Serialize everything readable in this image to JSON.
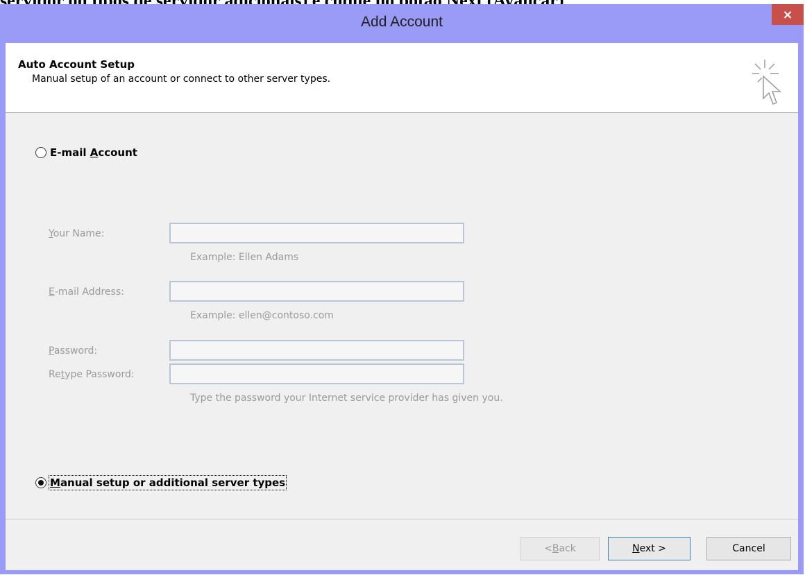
{
  "background_caption": "servidor ou tipos de servidor adicionais) e clique no botão Next (Avançar)",
  "window": {
    "title": "Add Account",
    "close_glyph": "×"
  },
  "header": {
    "title": "Auto Account Setup",
    "subtitle": "Manual setup of an account or connect to other server types.",
    "icon": "wizard-cursor-icon"
  },
  "options": {
    "email_account": {
      "label_prefix": "E-mail ",
      "accel": "A",
      "label_rest": "ccount",
      "selected": false
    },
    "manual_setup": {
      "accel": "M",
      "label_rest": "anual setup or additional server types",
      "selected": true
    }
  },
  "form": {
    "your_name": {
      "accel": "Y",
      "label_rest": "our Name:",
      "value": "",
      "hint": "Example: Ellen Adams"
    },
    "email_address": {
      "accel": "E",
      "label_rest": "-mail Address:",
      "value": "",
      "hint": "Example: ellen@contoso.com"
    },
    "password": {
      "accel": "P",
      "label_rest": "assword:",
      "value": ""
    },
    "retype_password": {
      "label_prefix": "Re",
      "accel": "t",
      "label_rest": "ype Password:",
      "value": ""
    },
    "password_hint": "Type the password your Internet service provider has given you."
  },
  "buttons": {
    "back": {
      "prefix": "< ",
      "accel": "B",
      "rest": "ack",
      "enabled": false
    },
    "next": {
      "accel": "N",
      "rest": "ext >",
      "enabled": true
    },
    "cancel": {
      "label": "Cancel"
    }
  },
  "colors": {
    "title_bar": "#9a9af7",
    "close_button": "#c7504a",
    "dialog_bg": "#f0f0f0"
  }
}
